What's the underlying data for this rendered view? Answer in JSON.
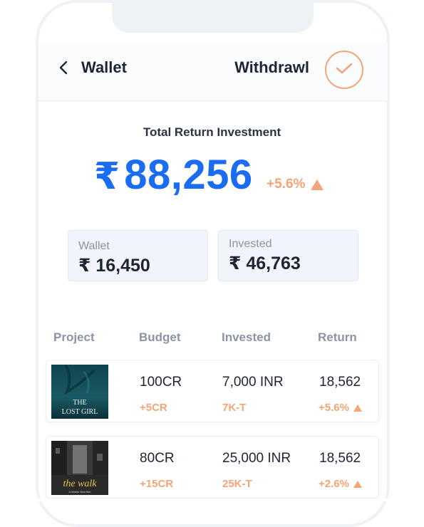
{
  "header": {
    "title": "Wallet",
    "action_label": "Withdrawl"
  },
  "summary": {
    "label": "Total Return Investment",
    "currency": "₹",
    "amount": "88,256",
    "change": "+5.6%"
  },
  "cards": [
    {
      "label": "Wallet",
      "value": "₹ 16,450"
    },
    {
      "label": "Invested",
      "value": "₹ 46,763"
    }
  ],
  "table": {
    "headers": [
      "Project",
      "Budget",
      "Invested",
      "Return"
    ],
    "rows": [
      {
        "poster_title_line1": "THE",
        "poster_title_line2": "LOST GIRL",
        "budget": "100CR",
        "budget_change": "+5CR",
        "invested": "7,000 INR",
        "invested_sub": "7K-T",
        "return": "18,562",
        "return_change": "+5.6%"
      },
      {
        "poster_title_line1": "the walk",
        "poster_title_line2": "A Martin Nick film",
        "budget": "80CR",
        "budget_change": "+15CR",
        "invested": "25,000 INR",
        "invested_sub": "25K-T",
        "return": "18,562",
        "return_change": "+2.6%"
      }
    ]
  },
  "colors": {
    "accent_blue": "#1a6cf0",
    "accent_orange": "#f5a477",
    "text_dark": "#1d2433",
    "text_muted": "#8b94a5"
  },
  "icons": {
    "back": "chevron-left-icon",
    "confirm": "check-icon",
    "up": "triangle-up-icon"
  }
}
